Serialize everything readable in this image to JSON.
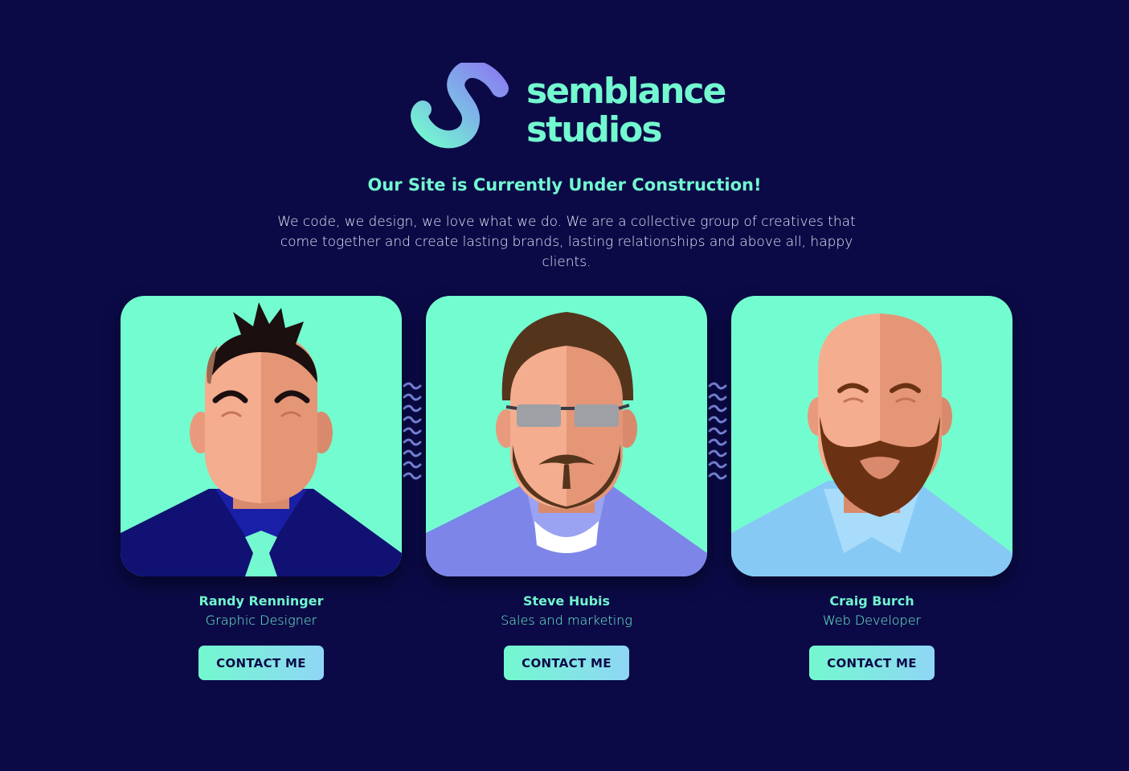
{
  "brand": {
    "line1": "semblance",
    "line2": "studios",
    "accent": "#73f8cf",
    "background": "#0b0a47"
  },
  "headline": "Our Site is Currently Under Construction!",
  "intro": "We code, we design, we love what we do. We are a collective group of creatives that come together and create lasting brands, lasting relationships and above all, happy clients.",
  "team": [
    {
      "name": "Randy Renninger",
      "role": "Graphic Designer",
      "button": "CONTACT ME",
      "avatar_icon": "avatar-randy-icon"
    },
    {
      "name": "Steve Hubis",
      "role": "Sales and marketing",
      "button": "CONTACT ME",
      "avatar_icon": "avatar-steve-icon"
    },
    {
      "name": "Craig Burch",
      "role": "Web Developer",
      "button": "CONTACT ME",
      "avatar_icon": "avatar-craig-icon"
    }
  ]
}
